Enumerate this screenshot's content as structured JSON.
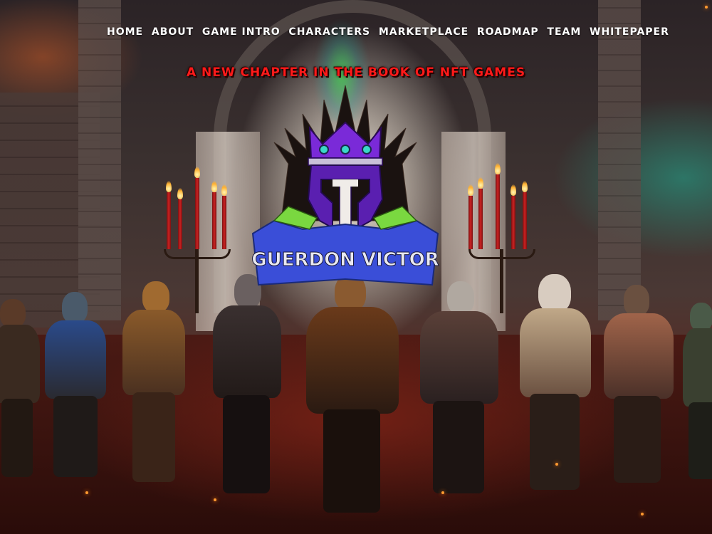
{
  "nav": {
    "items": [
      {
        "label": "HOME"
      },
      {
        "label": "ABOUT"
      },
      {
        "label": "GAME INTRO"
      },
      {
        "label": "CHARACTERS"
      },
      {
        "label": "MARKETPLACE"
      },
      {
        "label": "ROADMAP"
      },
      {
        "label": "TEAM"
      },
      {
        "label": "WHITEPAPER"
      }
    ]
  },
  "hero": {
    "tagline": "A NEW CHAPTER IN THE BOOK OF NFT GAMES",
    "logo_text": "GUERDON VICTOR"
  },
  "colors": {
    "tagline": "#ff1a1a",
    "nav_text": "#ffffff",
    "banner_blue": "#3a4ed8",
    "helmet_purple": "#5a1fb0",
    "crown_purple": "#7a2ad8"
  },
  "icons": {
    "logo": "spartan-helmet-crown-emblem"
  }
}
